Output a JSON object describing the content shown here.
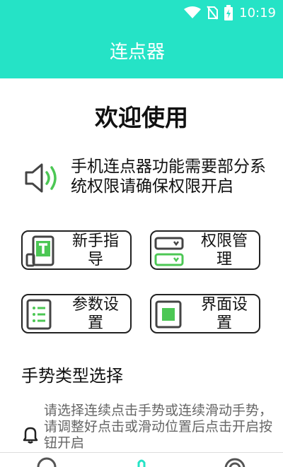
{
  "status_bar": {
    "time": "10:19",
    "icons": [
      "wifi-icon",
      "no-sim-icon",
      "battery-charging-icon"
    ]
  },
  "header": {
    "title": "连点器"
  },
  "welcome": {
    "title": "欢迎使用"
  },
  "notice": {
    "icon": "speaker-icon",
    "text": "手机连点器功能需要部分系统权限请确保权限开启"
  },
  "cards": [
    {
      "label": "新手指导",
      "icon": "guide-icon"
    },
    {
      "label": "权限管理",
      "icon": "permissions-icon"
    },
    {
      "label": "参数设置",
      "icon": "parameters-icon"
    },
    {
      "label": "界面设置",
      "icon": "interface-icon"
    }
  ],
  "gesture": {
    "title": "手势类型选择",
    "hint_icon": "bell-icon",
    "hint": "请选择连续点击手势或连续滑动手势，请调整好点击或滑动位置后点击开启按钮开启"
  },
  "bottom_nav": {
    "icons": [
      "help-icon",
      "touch-icon",
      "settings-icon"
    ]
  },
  "colors": {
    "accent": "#25e3c6",
    "icon_green": "#4cc754",
    "icon_dark": "#444444"
  }
}
